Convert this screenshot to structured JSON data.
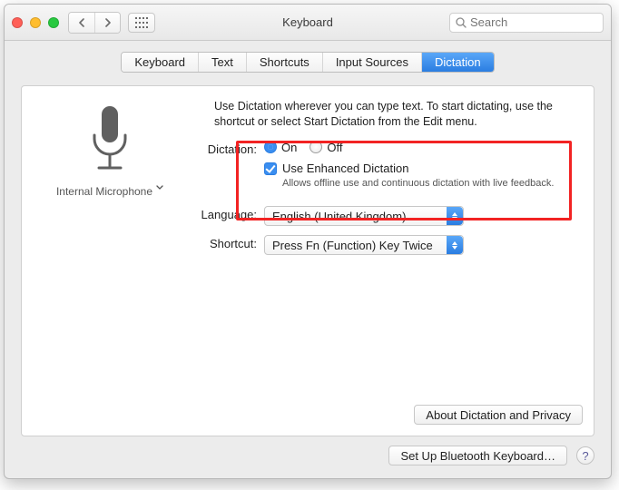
{
  "window": {
    "title": "Keyboard"
  },
  "search": {
    "placeholder": "Search"
  },
  "tabs": [
    {
      "label": "Keyboard"
    },
    {
      "label": "Text"
    },
    {
      "label": "Shortcuts"
    },
    {
      "label": "Input Sources"
    },
    {
      "label": "Dictation",
      "active": true
    }
  ],
  "mic": {
    "name": "Internal Microphone"
  },
  "intro": "Use Dictation wherever you can type text. To start dictating, use the shortcut or select Start Dictation from the Edit menu.",
  "dictation": {
    "label": "Dictation:",
    "on": "On",
    "off": "Off",
    "enhanced_label": "Use Enhanced Dictation",
    "enhanced_desc": "Allows offline use and continuous dictation with live feedback."
  },
  "language": {
    "label": "Language:",
    "value": "English (United Kingdom)"
  },
  "shortcut": {
    "label": "Shortcut:",
    "value": "Press Fn (Function) Key Twice"
  },
  "footer": {
    "about": "About Dictation and Privacy"
  },
  "bottom": {
    "bluetooth": "Set Up Bluetooth Keyboard…",
    "help": "?"
  }
}
